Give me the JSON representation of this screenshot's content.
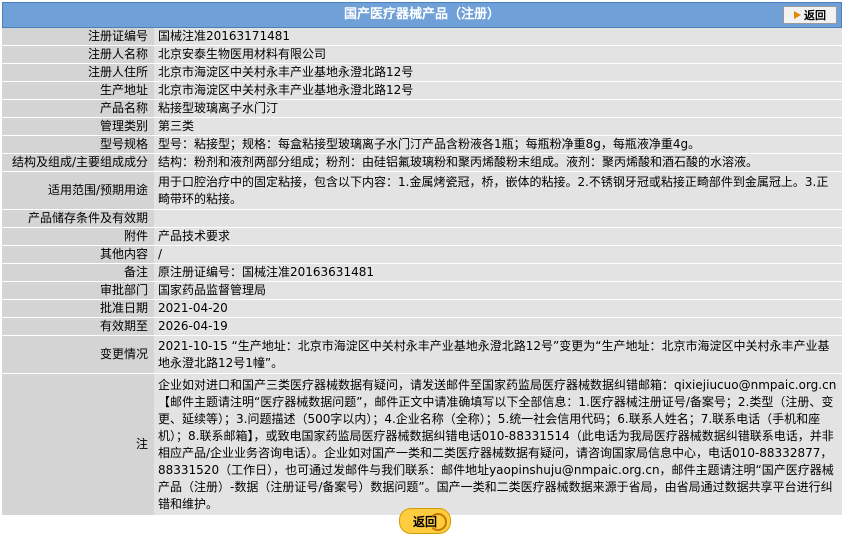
{
  "header": {
    "title": "国产医疗器械产品（注册）",
    "back_label": "返回"
  },
  "rows": [
    {
      "label": "注册证编号",
      "value": "国械注准20163171481"
    },
    {
      "label": "注册人名称",
      "value": "北京安泰生物医用材料有限公司"
    },
    {
      "label": "注册人住所",
      "value": "北京市海淀区中关村永丰产业基地永澄北路12号"
    },
    {
      "label": "生产地址",
      "value": "北京市海淀区中关村永丰产业基地永澄北路12号"
    },
    {
      "label": "产品名称",
      "value": "粘接型玻璃离子水门汀"
    },
    {
      "label": "管理类别",
      "value": "第三类"
    },
    {
      "label": "型号规格",
      "value": "型号：粘接型；规格：每盒粘接型玻璃离子水门汀产品含粉液各1瓶；每瓶粉净重8g，每瓶液净重4g。"
    },
    {
      "label": "结构及组成/主要组成成分",
      "value": "结构：粉剂和液剂两部分组成；粉剂：由硅铝氟玻璃粉和聚丙烯酸粉末组成。液剂：聚丙烯酸和酒石酸的水溶液。"
    },
    {
      "label": "适用范围/预期用途",
      "value": "用于口腔治疗中的固定粘接，包含以下内容：1.金属烤瓷冠，桥，嵌体的粘接。2.不锈钢牙冠或粘接正畸部件到金属冠上。3.正畸带环的粘接。"
    },
    {
      "label": "产品储存条件及有效期",
      "value": ""
    },
    {
      "label": "附件",
      "value": "产品技术要求"
    },
    {
      "label": "其他内容",
      "value": "/"
    },
    {
      "label": "备注",
      "value": "原注册证编号：国械注准20163631481"
    },
    {
      "label": "审批部门",
      "value": "国家药品监督管理局"
    },
    {
      "label": "批准日期",
      "value": "2021-04-20"
    },
    {
      "label": "有效期至",
      "value": "2026-04-19"
    },
    {
      "label": "变更情况",
      "value": "2021-10-15 “生产地址：北京市海淀区中关村永丰产业基地永澄北路12号”变更为“生产地址：北京市海淀区中关村永丰产业基地永澄北路12号1幢”。"
    },
    {
      "label": "注",
      "value": "企业如对进口和国产三类医疗器械数据有疑问，请发送邮件至国家药监局医疗器械数据纠错邮箱：qixiejiucuo@nmpaic.org.cn【邮件主题请注明“医疗器械数据问题”，邮件正文中请准确填写以下全部信息：1.医疗器械注册证号/备案号；2.类型（注册、变更、延续等）；3.问题描述（500字以内）；4.企业名称（全称）；5.统一社会信用代码；6.联系人姓名；7.联系电话（手机和座机）；8.联系邮箱】，或致电国家药监局医疗器械数据纠错电话010-88331514（此电话为我局医疗器械数据纠错联系电话，并非相应产品/企业业务咨询电话）。企业如对国产一类和二类医疗器械数据有疑问，请咨询国家局信息中心，电话010-88332877，88331520（工作日），也可通过发邮件与我们联系：邮件地址yaopinshuju@nmpaic.org.cn，邮件主题请注明“国产医疗器械产品（注册）-数据（注册证号/备案号）数据问题”。国产一类和二类医疗器械数据来源于省局，由省局通过数据共享平台进行纠错和维护。"
    }
  ],
  "footer": {
    "back_label": "返回"
  }
}
